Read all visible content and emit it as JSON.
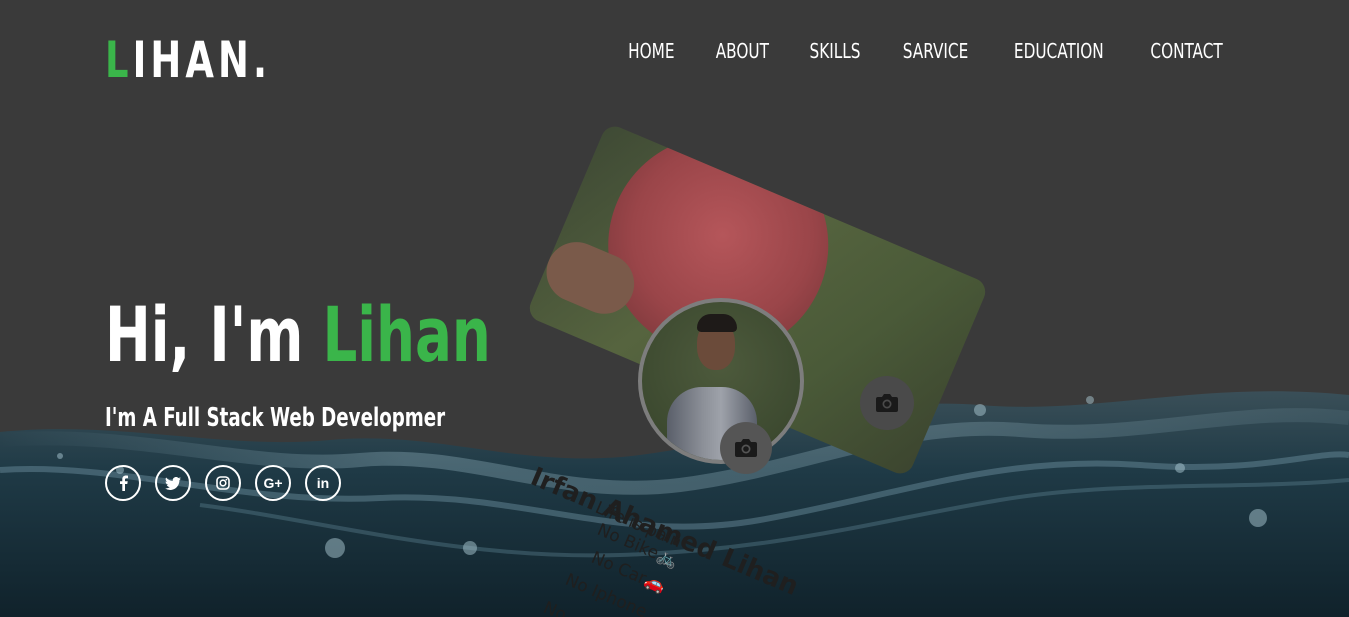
{
  "header": {
    "logo_first": "L",
    "logo_rest": "IHAN.",
    "nav": [
      {
        "label": "HOME"
      },
      {
        "label": "ABOUT"
      },
      {
        "label": "SKILLS"
      },
      {
        "label": "SARVICE"
      },
      {
        "label": "EDUCATION"
      },
      {
        "label": "CONTACT"
      }
    ]
  },
  "hero": {
    "greeting": "Hi, I'm ",
    "name": "Lihan",
    "subtitle": "I'm A Full Stack Web Developmer",
    "socials": [
      {
        "icon": "facebook-icon"
      },
      {
        "icon": "twitter-icon"
      },
      {
        "icon": "instagram-icon"
      },
      {
        "icon": "google-plus-icon",
        "text": "G+"
      },
      {
        "icon": "linkedin-icon",
        "text": "in"
      }
    ]
  },
  "profile_card": {
    "name": "Irfan Ahamed Lihan",
    "bio": [
      "Life is pain",
      "No Bike🚲",
      "No Car🚗",
      "No Iphone",
      "No..."
    ],
    "icons": [
      "camera-icon",
      "camera-icon"
    ]
  },
  "colors": {
    "accent": "#3ab54a",
    "background": "#3a3a3a",
    "text": "#ffffff"
  }
}
